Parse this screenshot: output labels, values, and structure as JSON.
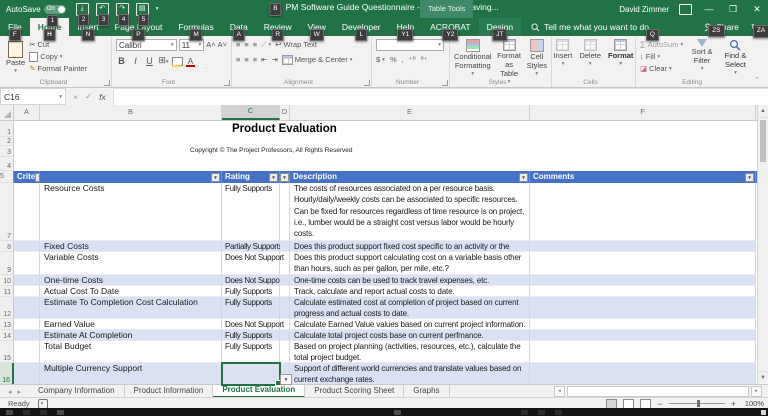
{
  "colors": {
    "excel_green": "#217346",
    "table_header_blue": "#4472C4",
    "band_blue": "#D9E1F2",
    "keytip_bg": "#3C3C3C"
  },
  "titlebar": {
    "autosave_label": "AutoSave",
    "autosave_state": "On",
    "autosave_keytip": "1",
    "qat_keytips": [
      "2",
      "3",
      "4",
      "5"
    ],
    "title_keytip": "B",
    "document_title": "PM Software Guide Questionnaire - temp.xlsx  -  Saving...",
    "table_tools_label": "Table Tools",
    "user_name": "David Zimmer"
  },
  "ribbon_tabs": [
    {
      "label": "File",
      "keytip": "F"
    },
    {
      "label": "Home",
      "keytip": "H"
    },
    {
      "label": "Insert",
      "keytip": "N"
    },
    {
      "label": "Page Layout",
      "keytip": "P"
    },
    {
      "label": "Formulas",
      "keytip": "M"
    },
    {
      "label": "Data",
      "keytip": "A"
    },
    {
      "label": "Review",
      "keytip": "R"
    },
    {
      "label": "View",
      "keytip": "W"
    },
    {
      "label": "Developer",
      "keytip": "L"
    },
    {
      "label": "Help",
      "keytip": "Y1"
    },
    {
      "label": "ACROBAT",
      "keytip": "Y2"
    },
    {
      "label": "Design",
      "keytip": "JT"
    }
  ],
  "search": {
    "label": "Tell me what you want to do",
    "keytip": "Q"
  },
  "share": {
    "label": "Share",
    "keytip": "ZS"
  },
  "history": {
    "keytip": "ZA"
  },
  "ribbon": {
    "clipboard": {
      "label": "Clipboard",
      "paste": "Paste",
      "cut": "Cut",
      "copy": "Copy",
      "format_painter": "Format Painter"
    },
    "font": {
      "label": "Font",
      "family": "Calibri",
      "size": "11"
    },
    "alignment": {
      "label": "Alignment",
      "wrap_text": "Wrap Text",
      "merge_center": "Merge & Center"
    },
    "number": {
      "label": "Number",
      "dollar": "$",
      "percent": "%",
      "comma": ","
    },
    "styles": {
      "label": "Styles",
      "conditional": "Conditional Formatting",
      "format_table": "Format as Table",
      "cell_styles": "Cell Styles"
    },
    "cells": {
      "label": "Cells",
      "insert": "Insert",
      "delete": "Delete",
      "format": "Format"
    },
    "editing": {
      "label": "Editing",
      "autosum": "AutoSum",
      "fill": "Fill",
      "clear": "Clear",
      "sort_filter": "Sort & Filter",
      "find_select": "Find & Select"
    }
  },
  "formula_bar": {
    "name_box": "C16",
    "formula": ""
  },
  "grid": {
    "col_headers": [
      "A",
      "B",
      "C",
      "D",
      "E",
      "F"
    ],
    "selected_column": "C",
    "row_numbers_pre": [
      "1",
      "2",
      "3",
      "4"
    ],
    "header_row_number": "5",
    "title": "Product Evaluation",
    "copyright": "Copyright © The Project Professors, All Rights Reserved",
    "header": {
      "criteria": "Crite",
      "rating": "Rating",
      "description": "Description",
      "comments": "Comments"
    },
    "rows": [
      {
        "num": "7",
        "criteria": "Resource Costs",
        "rating": "Fully Supports",
        "description": "The costs of resources associated on a per resource basis.\nHourly/daily/weekly costs can be associated to specific resources.\nCan be fixed for resources regardless of time resource is on project,\ni.e., lumber would be a straight cost versus labor would be hourly\ncosts."
      },
      {
        "num": "8",
        "criteria": "Fixed Costs",
        "rating": "Partially Supports",
        "description": "Does this product support fixed cost specific to an activity or the"
      },
      {
        "num": "9",
        "criteria": "Variable Costs",
        "rating": "Does Not Support",
        "description": "Does this product support calculating cost on a variable basis other\nthan hours, such as per gallon, per mile, etc.?"
      },
      {
        "num": "10",
        "criteria": "One-time Costs",
        "rating": "Does Not Support",
        "description": "One-time costs can be used to track travel expenses, etc."
      },
      {
        "num": "11",
        "criteria": "Actual Cost To Date",
        "rating": "Fully Supports",
        "description": "Track, calculate and report actual costs to date."
      },
      {
        "num": "12",
        "criteria": "Estimate To Completion Cost Calculation",
        "rating": "Fully Supports",
        "description": "Calculate estimated cost at completion of project based on current\nprogress and actual costs to date."
      },
      {
        "num": "13",
        "criteria": "Earned Value",
        "rating": "Does Not Support",
        "description": "Calculate Earned Value values based on current project information."
      },
      {
        "num": "14",
        "criteria": "Estimate At Completion",
        "rating": "Fully Supports",
        "description": "Calculate total project costs base on current perfmance."
      },
      {
        "num": "15",
        "criteria": "Total Budget",
        "rating": "Fully Supports",
        "description": "Based on project planning (activities, resources, etc.), calculate the\ntotal project budget."
      },
      {
        "num": "16",
        "criteria": "Multiple Currency Support",
        "rating": "",
        "description": "Support of different world currencies and translate values based on\ncurrent exchange rates."
      }
    ]
  },
  "sheet_tabs": [
    {
      "label": "Company Information"
    },
    {
      "label": "Product Information"
    },
    {
      "label": "Product Evaluation"
    },
    {
      "label": "Product Scoring Sheet"
    },
    {
      "label": "Graphs"
    }
  ],
  "status_bar": {
    "mode": "Ready",
    "zoom_level": "100%"
  }
}
